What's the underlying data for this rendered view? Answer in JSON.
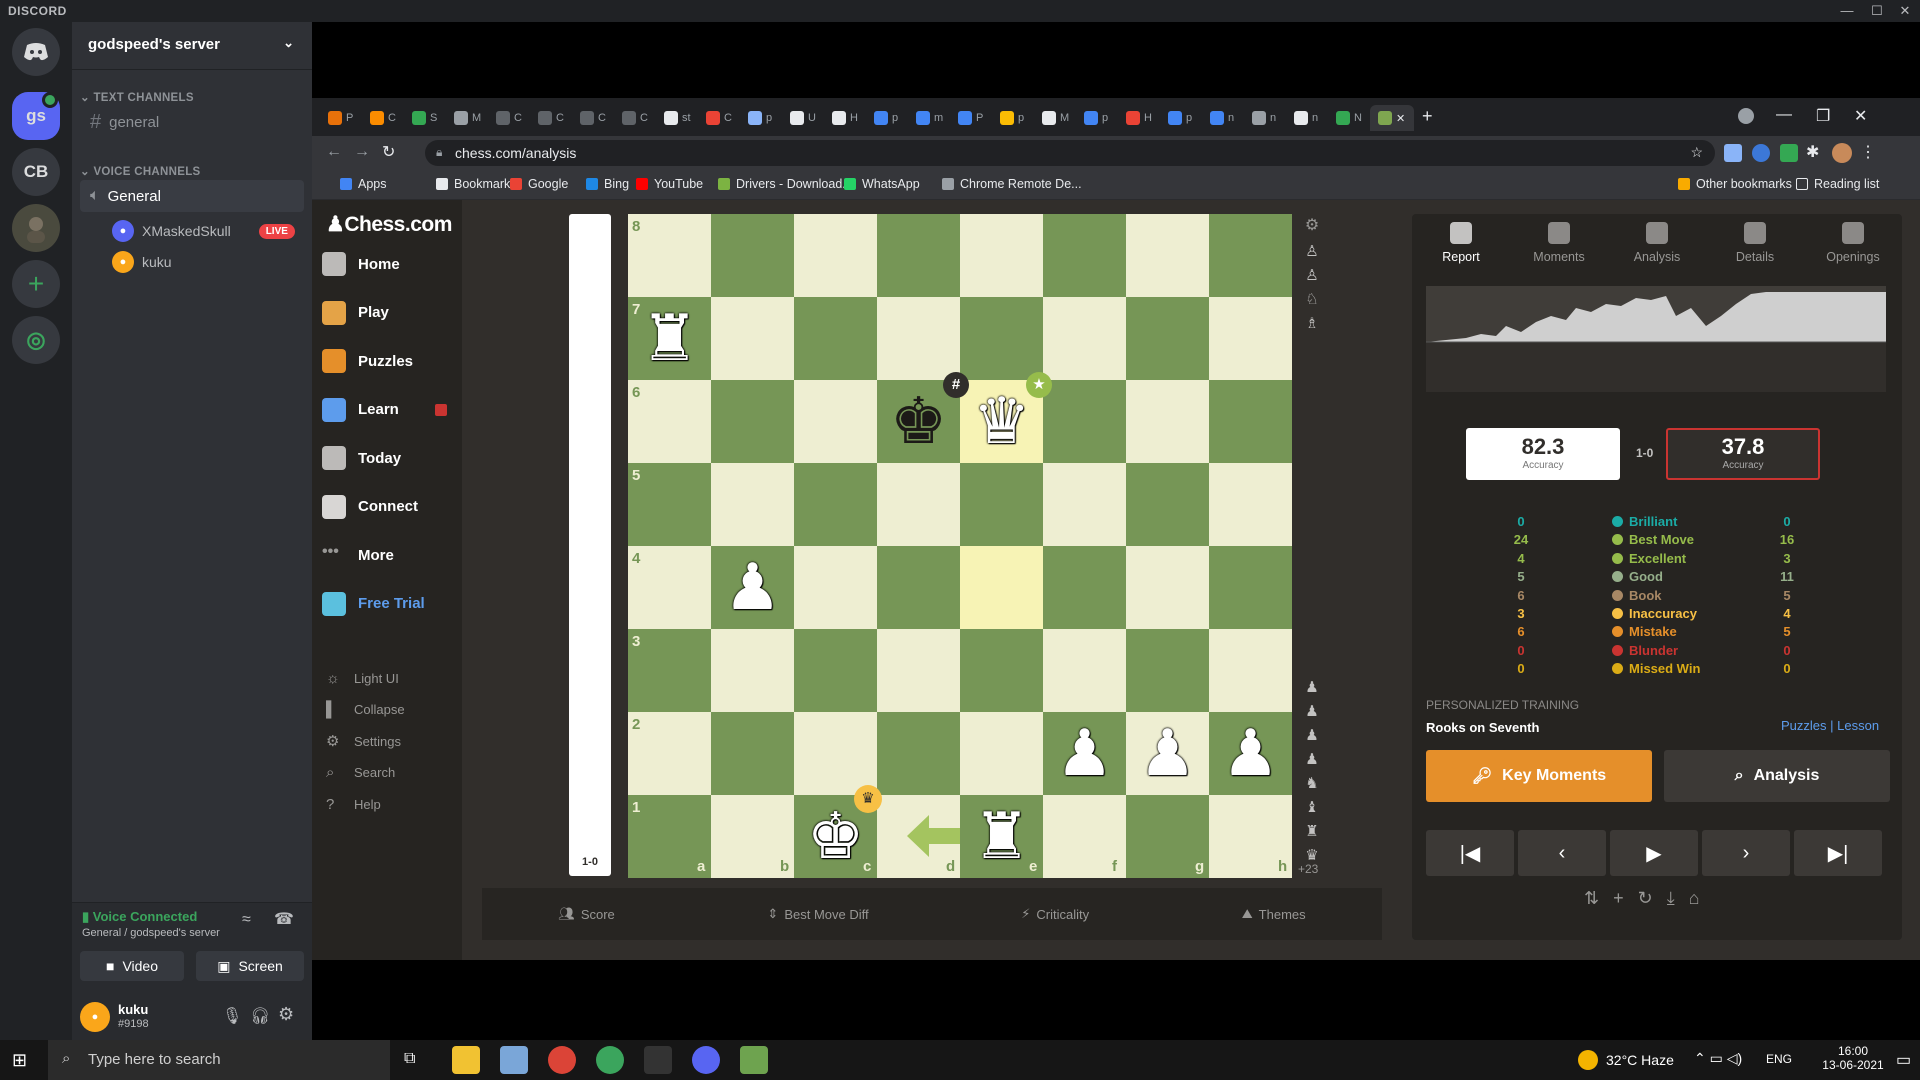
{
  "discord": {
    "brand": "DISCORD",
    "servers": [
      "gs",
      "CB"
    ],
    "server_name": "godspeed's server",
    "text_category": "TEXT CHANNELS",
    "text_channel": "general",
    "voice_category": "VOICE CHANNELS",
    "voice_channel": "General",
    "voice_users": [
      {
        "name": "XMaskedSkull",
        "badge": "LIVE"
      },
      {
        "name": "kuku"
      }
    ],
    "voice_status": "Voice Connected",
    "voice_location": "General / godspeed's server",
    "video_label": "Video",
    "screen_label": "Screen",
    "user": {
      "name": "kuku",
      "tag": "#9198"
    }
  },
  "browser": {
    "url": "chess.com/analysis",
    "bookmarks": [
      "Apps",
      "Bookmarks",
      "Google",
      "Bing",
      "YouTube",
      "Drivers - Download...",
      "WhatsApp",
      "Chrome Remote De..."
    ],
    "other_bookmarks": "Other bookmarks",
    "reading_list": "Reading list",
    "tab_letters": [
      "P",
      "C",
      "S",
      "M",
      "C",
      "C",
      "C",
      "C",
      "st",
      "C",
      "p",
      "U",
      "H",
      "p",
      "m",
      "P",
      "p",
      "M",
      "p",
      "H",
      "p",
      "n",
      "n",
      "n",
      "N"
    ]
  },
  "chess_nav": {
    "logo": "Chess.com",
    "items": [
      "Home",
      "Play",
      "Puzzles",
      "Learn",
      "Today",
      "Connect",
      "More",
      "Free Trial"
    ],
    "secondary": [
      "Light UI",
      "Collapse",
      "Settings",
      "Search",
      "Help"
    ]
  },
  "board": {
    "ranks": [
      "8",
      "7",
      "6",
      "5",
      "4",
      "3",
      "2",
      "1"
    ],
    "files": [
      "a",
      "b",
      "c",
      "d",
      "e",
      "f",
      "g",
      "h"
    ],
    "result": "1-0",
    "captured_advantage": "+23",
    "eval_white_fraction": 1.0,
    "pieces": [
      {
        "sq": "a7",
        "glyph": "♜",
        "color": "white"
      },
      {
        "sq": "d6",
        "glyph": "♚",
        "color": "black"
      },
      {
        "sq": "e6",
        "glyph": "♛",
        "color": "white"
      },
      {
        "sq": "b4",
        "glyph": "♟",
        "color": "white"
      },
      {
        "sq": "f2",
        "glyph": "♟",
        "color": "white"
      },
      {
        "sq": "g2",
        "glyph": "♟",
        "color": "white"
      },
      {
        "sq": "h2",
        "glyph": "♟",
        "color": "white"
      },
      {
        "sq": "c1",
        "glyph": "♚",
        "color": "white"
      },
      {
        "sq": "e1",
        "glyph": "♜",
        "color": "white"
      }
    ],
    "highlights": [
      "e6",
      "e4"
    ],
    "checkmate_badge": "#",
    "best_badge": "★",
    "winner_badge": "♛"
  },
  "bottom_tabs": [
    "Score",
    "Best Move Diff",
    "Criticality",
    "Themes"
  ],
  "report": {
    "tabs": [
      "Report",
      "Moments",
      "Analysis",
      "Details",
      "Openings"
    ],
    "white_accuracy": "82.3",
    "black_accuracy": "37.8",
    "accuracy_label": "Accuracy",
    "result": "1-0",
    "classifications": [
      {
        "label": "Brilliant",
        "white": "0",
        "black": "0",
        "color": "#1baca6"
      },
      {
        "label": "Best Move",
        "white": "24",
        "black": "16",
        "color": "#96bc4b"
      },
      {
        "label": "Excellent",
        "white": "4",
        "black": "3",
        "color": "#96bc4b"
      },
      {
        "label": "Good",
        "white": "5",
        "black": "11",
        "color": "#96af8b"
      },
      {
        "label": "Book",
        "white": "6",
        "black": "5",
        "color": "#a88865"
      },
      {
        "label": "Inaccuracy",
        "white": "3",
        "black": "4",
        "color": "#f7c045"
      },
      {
        "label": "Mistake",
        "white": "6",
        "black": "5",
        "color": "#e58f2a"
      },
      {
        "label": "Blunder",
        "white": "0",
        "black": "0",
        "color": "#ca3431"
      },
      {
        "label": "Missed Win",
        "white": "0",
        "black": "0",
        "color": "#dbac16"
      }
    ],
    "training_title": "PERSONALIZED TRAINING",
    "training_item": "Rooks on Seventh",
    "puzzles_link": "Puzzles",
    "lesson_link": "Lesson",
    "key_moments": "Key Moments",
    "analysis_btn": "Analysis"
  },
  "taskbar": {
    "search_placeholder": "Type here to search",
    "weather": "32°C  Haze",
    "lang": "ENG",
    "time": "16:00",
    "date": "13-06-2021"
  }
}
